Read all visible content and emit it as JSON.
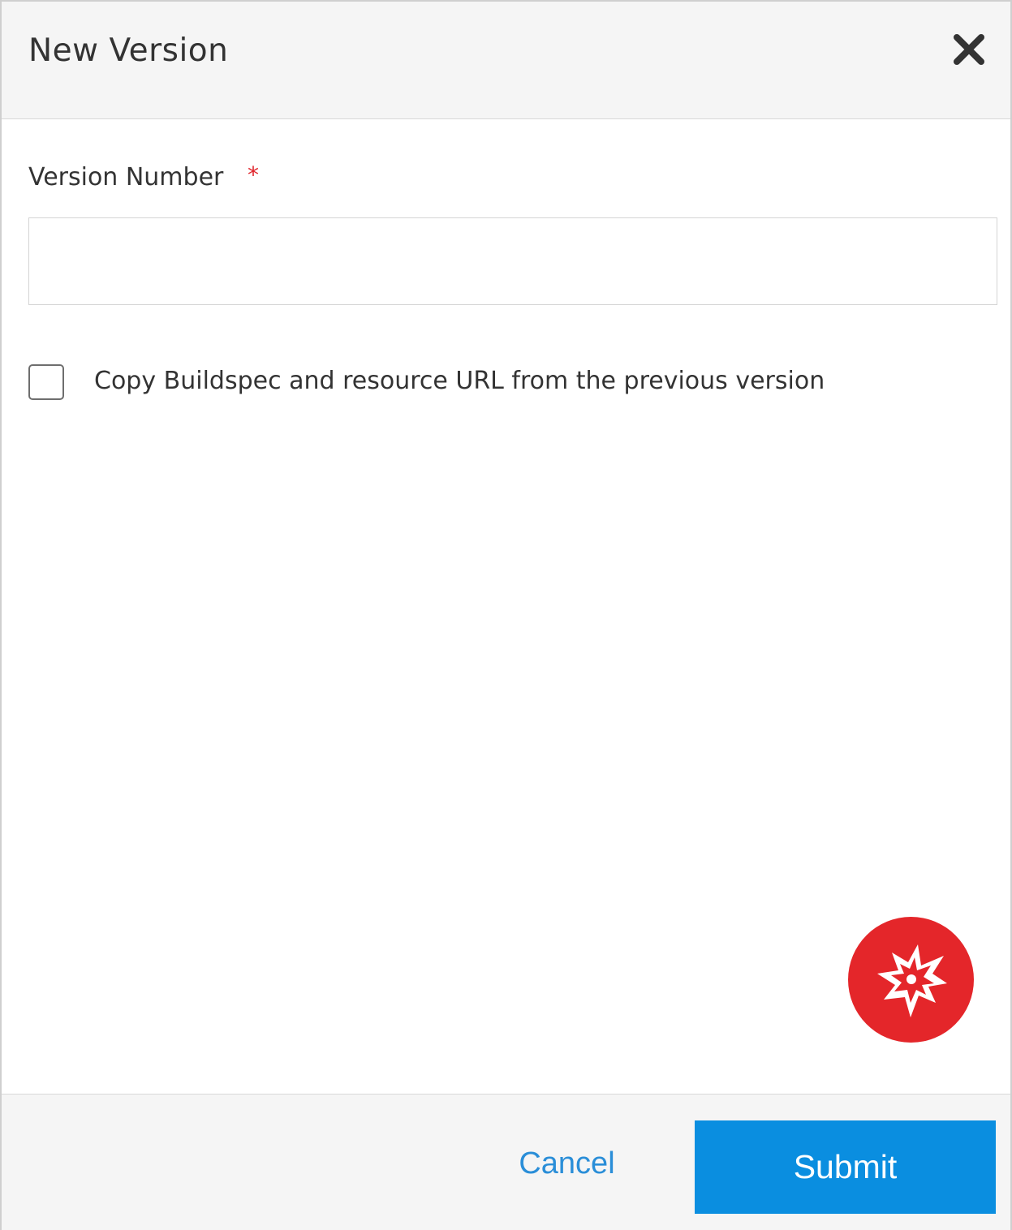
{
  "dialog": {
    "title": "New Version",
    "close_icon": "close-icon"
  },
  "form": {
    "version_number": {
      "label": "Version Number",
      "required_mark": "*",
      "value": "",
      "placeholder": ""
    },
    "copy_option": {
      "label": "Copy Buildspec and resource URL from the previous version",
      "checked": false
    }
  },
  "fab": {
    "icon": "starburst-logo-icon",
    "color": "#e4262a"
  },
  "footer": {
    "cancel_label": "Cancel",
    "submit_label": "Submit"
  },
  "colors": {
    "accent": "#0a8ee0",
    "link": "#2a8ed8",
    "required": "#e0262d",
    "header_bg": "#f5f5f5"
  }
}
